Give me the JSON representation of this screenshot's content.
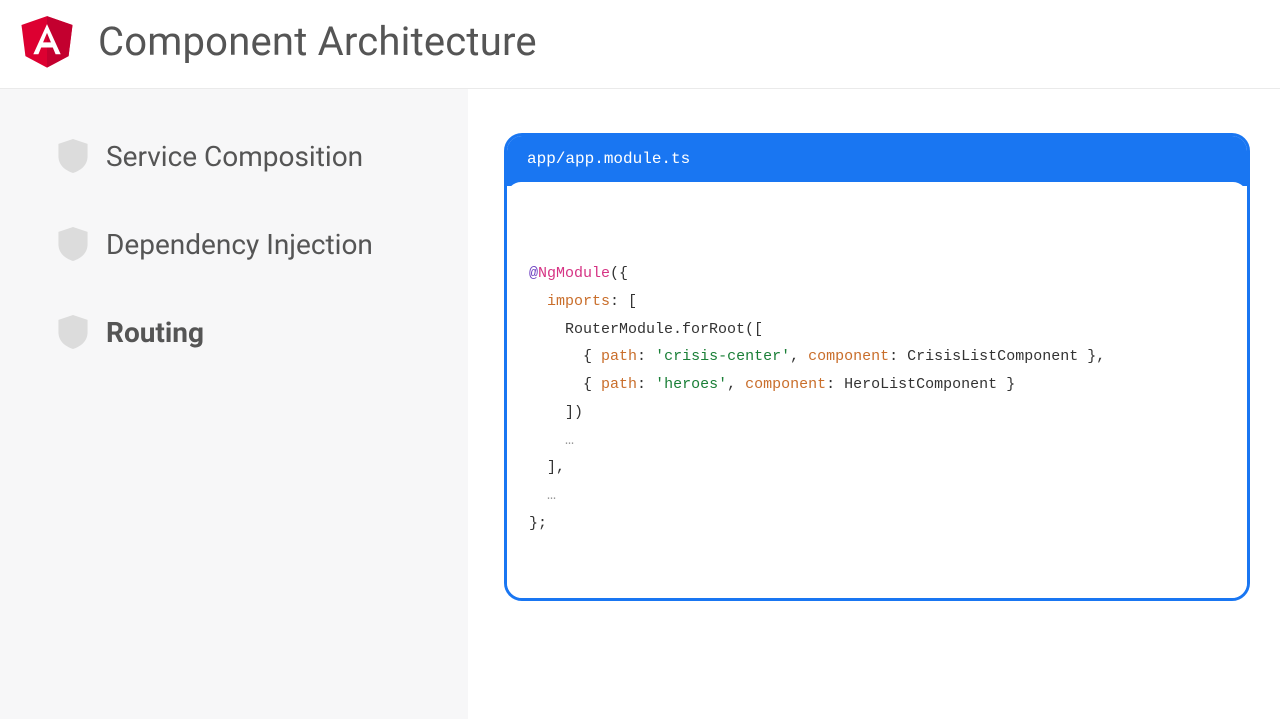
{
  "header": {
    "title": "Component Architecture"
  },
  "sidebar": {
    "items": [
      {
        "label": "Service Composition",
        "active": false
      },
      {
        "label": "Dependency Injection",
        "active": false
      },
      {
        "label": "Routing",
        "active": true
      }
    ]
  },
  "code": {
    "filename": "app/app.module.ts",
    "tokens": {
      "at": "@",
      "decorator": "NgModule",
      "openParenBrace": "({",
      "imports": "imports",
      "colon": ":",
      "openBracket": " [",
      "routerFor": "RouterModule.forRoot([",
      "bracePathOpen": "{ ",
      "path": "path",
      "crisis": "'crisis-center'",
      "component": "component",
      "crisisComp": "CrisisListComponent",
      "heroes": "'heroes'",
      "heroComp": "HeroListComponent",
      "closeRouteComma": " },",
      "closeRoute": " }",
      "closeForRoot": "])",
      "ellipsis": "…",
      "closeImports": "],",
      "closeModule": "};"
    }
  }
}
